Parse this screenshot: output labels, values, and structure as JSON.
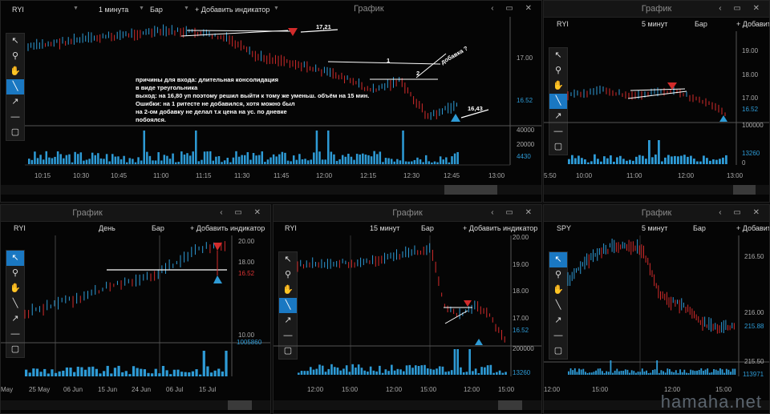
{
  "windows": {
    "main": {
      "title": "График",
      "ticker": "RYI",
      "interval": "1 минута",
      "chart_type": "Бар",
      "add_indicator": "+ Добавить индикатор",
      "prices": [
        "17.00",
        "16.52"
      ],
      "volumes": [
        "40000",
        "20000",
        "4430"
      ],
      "times": [
        "10:15",
        "10:30",
        "10:45",
        "11:00",
        "11:15",
        "11:30",
        "11:45",
        "12:00",
        "12:15",
        "12:30",
        "12:45",
        "13:00"
      ],
      "annotations": {
        "price_top": "17,21",
        "price_bottom": "16,43",
        "label_1": "1",
        "label_2": "2",
        "label_add": "добавка ?",
        "note_lines": [
          "причины для входа: длительная консолидация",
          "в виде треугольника",
          "выход: на 16,80  уп поэтому решил выйти  к тому же уменьш. объём на 15 мин.",
          "Ошибки: на 1 ритесте не добавился, хотя можно был",
          "на 2-ом добавку не делал т.к цена  на ус. по дневке",
          "побоялся."
        ]
      }
    },
    "top_right": {
      "title": "График",
      "ticker": "RYI",
      "interval": "5 минут",
      "chart_type": "Бар",
      "add_indicator": "+ Добавить",
      "prices": [
        "19.00",
        "18.00",
        "17.00",
        "16.52"
      ],
      "volumes": [
        "100000",
        "13260",
        "0"
      ],
      "times": [
        "5:50",
        "10:00",
        "11:00",
        "12:00",
        "13:00"
      ]
    },
    "bottom_left": {
      "title": "График",
      "ticker": "RYI",
      "interval": "День",
      "chart_type": "Бар",
      "add_indicator": "+ Добавить индикатор",
      "prices": [
        "20.00",
        "18.00",
        "16.52",
        "10.00"
      ],
      "volumes": [
        "1005860"
      ],
      "times": [
        "May",
        "25 May",
        "06 Jun",
        "15 Jun",
        "24 Jun",
        "06 Jul",
        "15 Jul"
      ]
    },
    "bottom_middle": {
      "title": "График",
      "ticker": "RYI",
      "interval": "15 минут",
      "chart_type": "Бар",
      "add_indicator": "+ Добавить индикатор",
      "prices": [
        "20.00",
        "19.00",
        "18.00",
        "17.00",
        "16.52"
      ],
      "volumes": [
        "200000",
        "13260"
      ],
      "times": [
        "12:00",
        "15:00",
        "12:00",
        "15:00",
        "12:00",
        "15:00"
      ]
    },
    "bottom_right": {
      "title": "График",
      "ticker": "SPY",
      "interval": "5 минут",
      "chart_type": "Бар",
      "add_indicator": "+ Добавить",
      "prices": [
        "216.50",
        "216.00",
        "215.88",
        "215.50"
      ],
      "volumes": [
        "113971"
      ],
      "times": [
        "12:00",
        "15:00",
        "12:00",
        "15:00"
      ]
    }
  },
  "watermark": "hamaha.net",
  "colors": {
    "up": "#2e9bd6",
    "down": "#d22b2b",
    "accent": "#1a78c2"
  },
  "tools": [
    "cursor-icon",
    "zoom-icon",
    "hand-icon",
    "line-icon",
    "arrow-icon",
    "hline-icon",
    "rect-icon"
  ]
}
